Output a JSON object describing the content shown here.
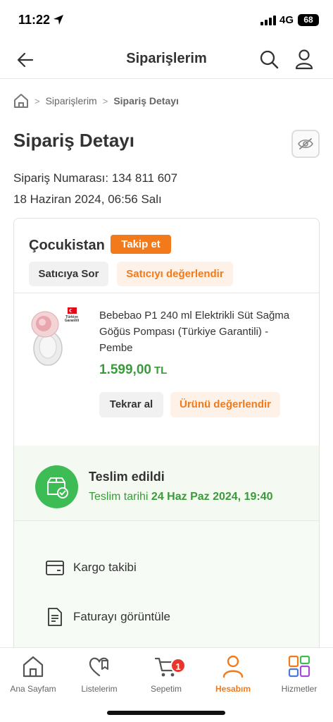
{
  "status_bar": {
    "time": "11:22",
    "network": "4G",
    "battery": "68"
  },
  "header": {
    "title": "Siparişlerim"
  },
  "breadcrumb": {
    "items": [
      "Siparişlerim",
      "Sipariş Detayı"
    ]
  },
  "page": {
    "title": "Sipariş Detayı",
    "order_number": "Sipariş Numarası: 134 811 607",
    "order_date": "18 Haziran 2024, 06:56 Salı"
  },
  "seller": {
    "name": "Çocukistan",
    "follow_label": "Takip et",
    "ask_label": "Satıcıya Sor",
    "rate_label": "Satıcıyı değerlendir"
  },
  "product": {
    "name": "Bebebao P1 240 ml Elektrikli Süt Sağma Göğüs Pompası (Türkiye Garantili) - Pembe",
    "price": "1.599,00",
    "currency": "TL",
    "reorder_label": "Tekrar al",
    "rate_label": "Ürünü değerlendir",
    "badge_text": "Türkiye Garantili"
  },
  "delivery": {
    "status": "Teslim edildi",
    "date_label": "Teslim tarihi",
    "date_value": "24 Haz Paz 2024, 19:40"
  },
  "actions": {
    "tracking": "Kargo takibi",
    "invoice": "Faturayı görüntüle"
  },
  "tabbar": {
    "tabs": [
      {
        "label": "Ana Sayfam",
        "icon": "home-icon"
      },
      {
        "label": "Listelerim",
        "icon": "heart-list-icon"
      },
      {
        "label": "Sepetim",
        "icon": "cart-icon"
      },
      {
        "label": "Hesabım",
        "icon": "user-icon"
      },
      {
        "label": "Hizmetler",
        "icon": "services-icon"
      }
    ],
    "cart_badge": "1",
    "active_tab": "Hesabım"
  },
  "colors": {
    "brand": "#f27a1a",
    "success": "#3dbb55",
    "badge": "#e8362c"
  }
}
